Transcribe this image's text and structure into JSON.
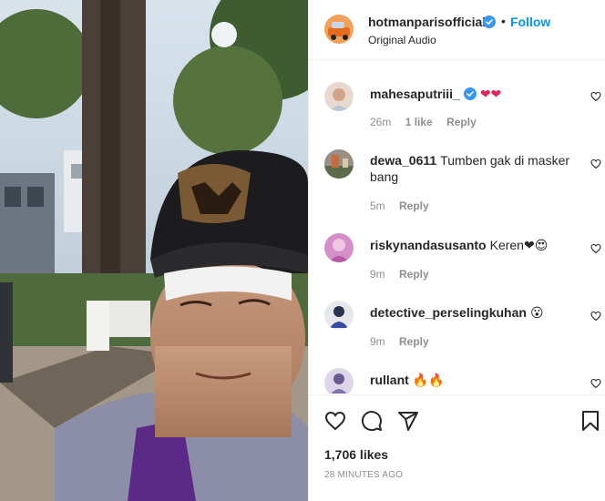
{
  "post": {
    "author": "hotmanparisofficial",
    "follow_label": "Follow",
    "audio": "Original Audio",
    "dot": "•"
  },
  "comments": [
    {
      "username": "mahesaputriii_",
      "verified": true,
      "text": "❤❤",
      "time": "26m",
      "likes": "1 like",
      "reply": "Reply"
    },
    {
      "username": "dewa_0611",
      "verified": false,
      "text": "Tumben gak di masker bang",
      "time": "5m",
      "likes": "",
      "reply": "Reply"
    },
    {
      "username": "riskynandasusanto",
      "verified": false,
      "text": "Keren❤😍",
      "time": "9m",
      "likes": "",
      "reply": "Reply"
    },
    {
      "username": "detective_perselingkuhan",
      "verified": false,
      "text": "😮",
      "time": "9m",
      "likes": "",
      "reply": "Reply"
    },
    {
      "username": "rullant",
      "verified": false,
      "text": "🔥🔥",
      "time": "",
      "likes": "",
      "reply": ""
    }
  ],
  "footer": {
    "likes": "1,706 likes",
    "time_ago": "28 MINUTES AGO"
  },
  "icons": {
    "like": "heart-icon",
    "comment": "comment-icon",
    "share": "share-icon",
    "save": "bookmark-icon"
  },
  "colors": {
    "follow": "#0095f6",
    "verified": "#3897f0",
    "muted": "#8e8e8e",
    "heart": "#e0245e"
  }
}
